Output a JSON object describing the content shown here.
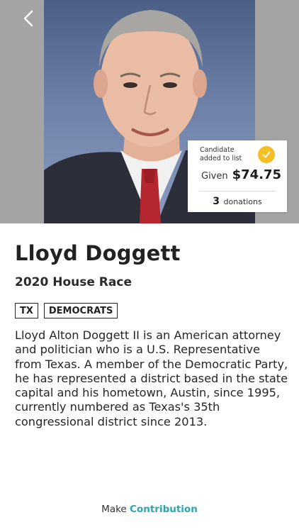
{
  "header": {
    "back_icon": "chevron-left-icon"
  },
  "badge": {
    "status_text": "Candidate added to list",
    "check_icon": "check-icon",
    "given_label": "Given",
    "given_amount": "$74.75",
    "donations_count": "3",
    "donations_label": "donations",
    "accent_color": "#f5be23"
  },
  "candidate": {
    "name": "Lloyd Doggett",
    "race": "2020 House Race",
    "tags": [
      "TX",
      "DEMOCRATS"
    ],
    "bio": "Lloyd Alton Doggett II is an American attorney and politician who is a U.S. Representative from Texas. A member of the Democratic Party, he has represented a district based in the state capital and his hometown, Austin, since 1995, currently numbered as Texas's 35th congressional district since 2013."
  },
  "footer": {
    "make_label": "Make",
    "contribution_label": "Contribution",
    "accent_color": "#2aa6b1"
  }
}
